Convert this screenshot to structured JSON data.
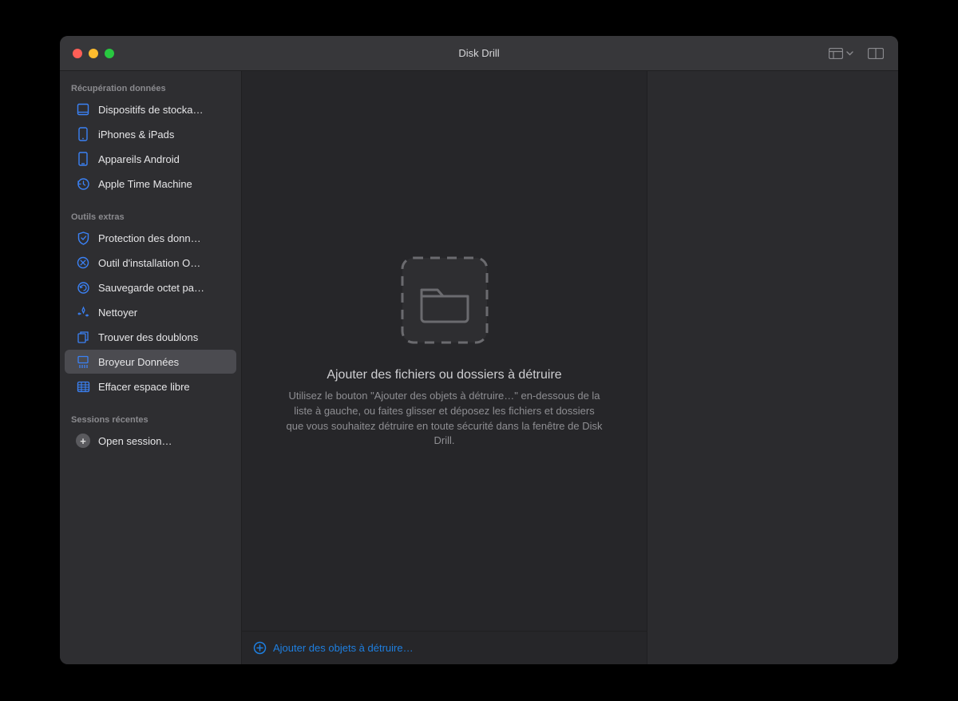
{
  "window": {
    "title": "Disk Drill"
  },
  "sidebar": {
    "sections": [
      {
        "label": "Récupération données",
        "items": [
          {
            "label": "Dispositifs de stocka…",
            "icon": "drive-icon"
          },
          {
            "label": "iPhones & iPads",
            "icon": "iphone-icon"
          },
          {
            "label": "Appareils Android",
            "icon": "android-icon"
          },
          {
            "label": "Apple Time Machine",
            "icon": "timemachine-icon"
          }
        ]
      },
      {
        "label": "Outils extras",
        "items": [
          {
            "label": "Protection des donn…",
            "icon": "shield-icon"
          },
          {
            "label": "Outil d'installation O…",
            "icon": "installer-icon"
          },
          {
            "label": "Sauvegarde octet pa…",
            "icon": "backup-icon"
          },
          {
            "label": "Nettoyer",
            "icon": "clean-icon"
          },
          {
            "label": "Trouver des doublons",
            "icon": "duplicates-icon"
          },
          {
            "label": "Broyeur Données",
            "icon": "shredder-icon",
            "selected": true
          },
          {
            "label": "Effacer espace libre",
            "icon": "erase-icon"
          }
        ]
      },
      {
        "label": "Sessions récentes",
        "items": [
          {
            "label": "Open session…",
            "icon": "plus-icon"
          }
        ]
      }
    ]
  },
  "main": {
    "heading": "Ajouter des fichiers ou dossiers à détruire",
    "subtext": "Utilisez le bouton \"Ajouter des objets à détruire…\" en-dessous de la liste à gauche, ou faites glisser et déposez les fichiers et dossiers que vous souhaitez détruire en toute sécurité dans la fenêtre de Disk Drill.",
    "add_button": "Ajouter des objets à détruire…"
  }
}
